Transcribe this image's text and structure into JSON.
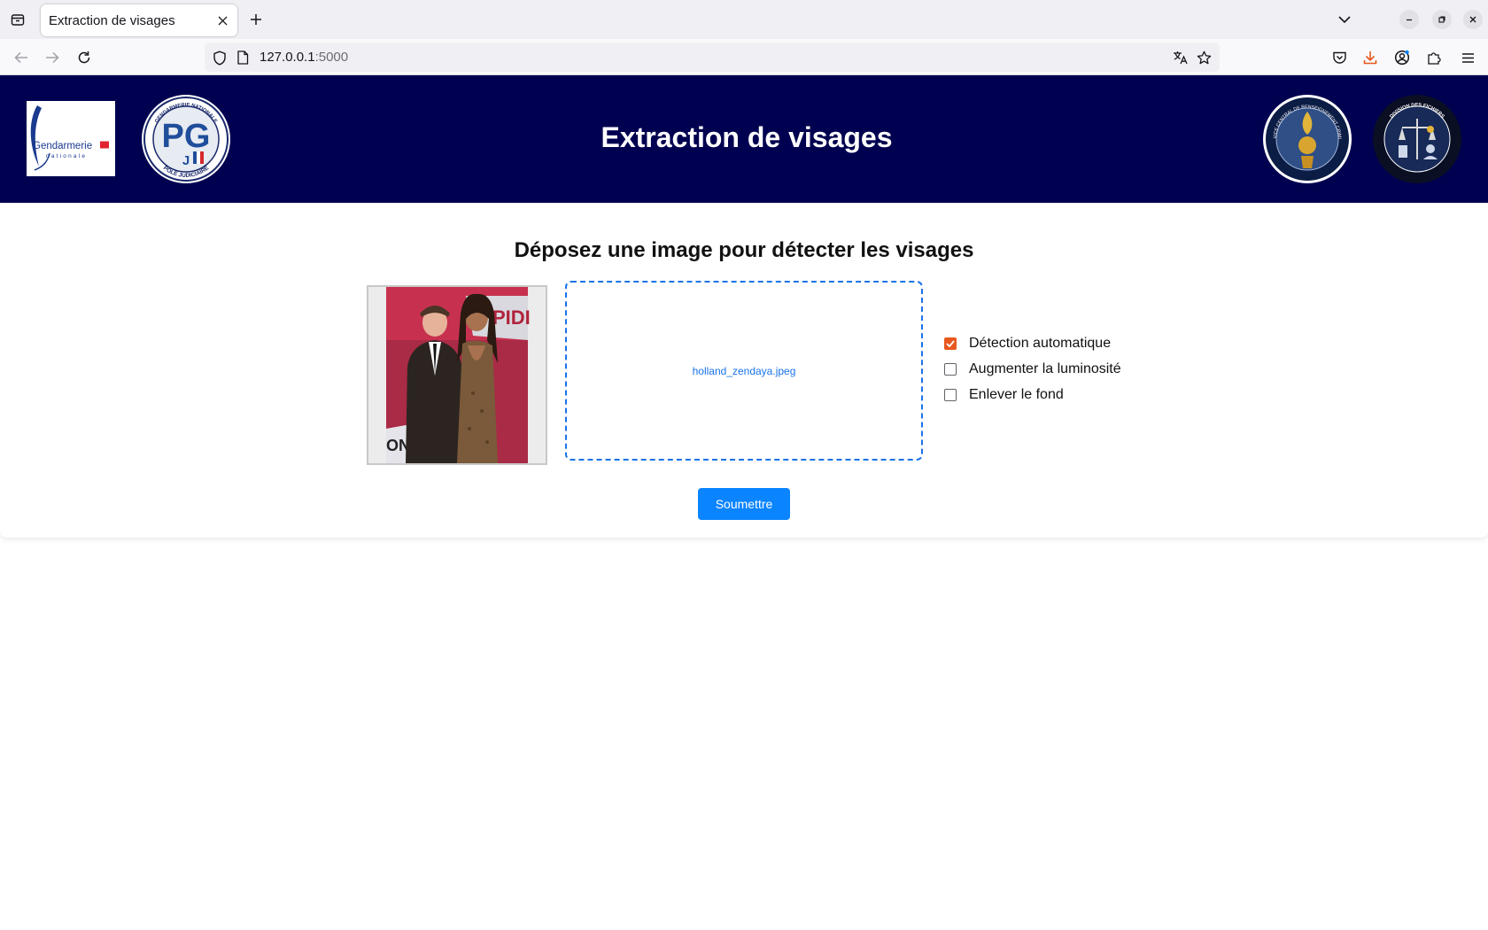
{
  "browser": {
    "tab_title": "Extraction de visages",
    "url_host": "127.0.0.1",
    "url_port": ":5000"
  },
  "header": {
    "title": "Extraction de visages",
    "logo_gendarmerie_text": "Gendarmerie nationale",
    "logo_pj_text": "GENDARMERIE NATIONALE · PÔLE JUDICIAIRE",
    "logo_scrc_text": "SERVICE CENTRAL DE RENSEIGNEMENT CRIMINEL · GENDARMERIE NATIONALE",
    "logo_division_text": "DIVISION DES FICHIERS · SERVICE CENTRAL DE RENSEIGNEMENT CRIMINEL"
  },
  "main": {
    "heading": "Déposez une image pour détecter les visages",
    "dropzone_file": "holland_zendaya.jpeg",
    "options": [
      {
        "label": "Détection automatique",
        "checked": true
      },
      {
        "label": "Augmenter la luminosité",
        "checked": false
      },
      {
        "label": "Enlever le fond",
        "checked": false
      }
    ],
    "submit_label": "Soumettre"
  },
  "colors": {
    "header_bg": "#000050",
    "accent": "#0a84ff",
    "dropzone_border": "#1a73e8",
    "checkbox_checked": "#e8571e"
  },
  "icons": [
    "tab-overview-icon",
    "close-icon",
    "plus-icon",
    "chevron-down-icon",
    "minimize-icon",
    "restore-icon",
    "back-arrow-icon",
    "forward-arrow-icon",
    "reload-icon",
    "shield-icon",
    "page-icon",
    "translate-icon",
    "star-icon",
    "pocket-icon",
    "download-icon",
    "account-icon",
    "extensions-icon",
    "menu-icon"
  ]
}
